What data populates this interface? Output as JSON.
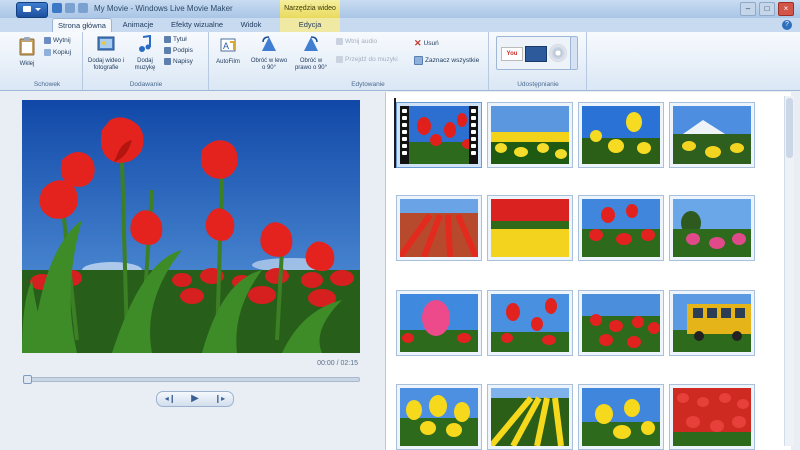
{
  "window": {
    "title": "My Movie - Windows Live Movie Maker",
    "context_tab_title": "Narzędzia wideo"
  },
  "tabs": [
    {
      "label": "Strona główna",
      "active": true
    },
    {
      "label": "Animacje"
    },
    {
      "label": "Efekty wizualne"
    },
    {
      "label": "Widok"
    },
    {
      "label": "Edycja",
      "context": true
    }
  ],
  "ribbon": {
    "groups": {
      "schowek": "Schowek",
      "dodawanie": "Dodawanie",
      "edytowanie": "Edytowanie",
      "udostepnianie": "Udostępnianie"
    },
    "buttons": {
      "paste": "Wklej",
      "cut": "Wytnij",
      "copy": "Kopiuj",
      "add_videos": "Dodaj wideo i fotografie",
      "add_music": "Dodaj muzykę",
      "title": "Tytuł",
      "caption": "Podpis",
      "credits": "Napisy",
      "automovie": "AutoFilm",
      "rotate_left": "Obróć w lewo o 90°",
      "rotate_right": "Obróć w prawo o 90°",
      "edit_music": "Wtnij audio",
      "snapshot": "Przejdź do muzyki",
      "remove": "Usuń",
      "select_all": "Zaznacz wszystkie"
    }
  },
  "preview": {
    "timecode": "00:00 / 02:15"
  },
  "colors": {
    "ribbon_bg": "#dbe7f5",
    "accent": "#1c4f9c",
    "context_tab": "#e9da5e",
    "selected_thumb": "#cfe2f7"
  },
  "icons": [
    "app-menu-icon",
    "save-icon",
    "undo-icon",
    "redo-icon",
    "paste-icon",
    "cut-icon",
    "copy-icon",
    "add-video-icon",
    "add-music-icon",
    "title-icon",
    "caption-icon",
    "credits-icon",
    "automovie-icon",
    "rotate-left-icon",
    "rotate-right-icon",
    "remove-icon",
    "select-all-icon",
    "youtube-icon",
    "share-icon",
    "dvd-icon",
    "play-icon",
    "previous-frame-icon",
    "next-frame-icon",
    "help-icon"
  ]
}
